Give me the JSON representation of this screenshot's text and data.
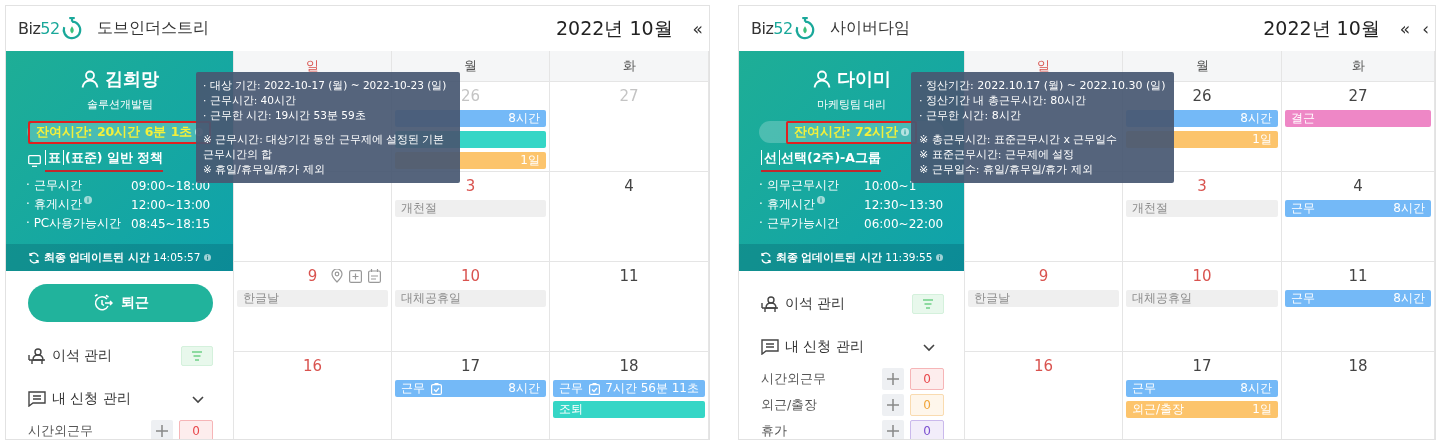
{
  "panels": [
    {
      "logo": {
        "text": "Biz",
        "accent": "52"
      },
      "company": "도브인더스트리",
      "month": "2022년 10월",
      "nav": [
        "«"
      ],
      "user": {
        "name": "김희망",
        "team": "솔루션개발팀"
      },
      "remaining": {
        "text": "잔여시간: 20시간 6분 1초",
        "highlighted": true
      },
      "policy": {
        "tag": "표",
        "name": "(표준) 일반 정책",
        "underlined": true
      },
      "hours": [
        {
          "label": "· 근무시간",
          "value": "09:00~18:00"
        },
        {
          "label": "· 휴게시간",
          "value": "12:00~13:00",
          "info": true
        },
        {
          "label": "· PC사용가능시간",
          "value": "08:45~18:15"
        }
      ],
      "updated": "**최종 업데이트된 시간** 14:05:57",
      "clock_out": "퇴근",
      "away": "이석 관리",
      "requests": {
        "title": "내 신청 관리",
        "expanded": true,
        "items": [
          {
            "label": "시간외근무",
            "count": "0",
            "color": "#e8474b"
          }
        ]
      },
      "weekdays": [
        {
          "label": "일",
          "holiday": true
        },
        {
          "label": "월",
          "holiday": false
        },
        {
          "label": "화",
          "holiday": false
        }
      ],
      "weeks": [
        {
          "monday": {
            "day": "26",
            "other_month": true,
            "events": [
              {
                "kind": "work",
                "value": "8시간"
              },
              {
                "kind": "early_leave"
              },
              {
                "kind": "outside",
                "value": "1일"
              }
            ]
          },
          "tuesday": {
            "day": "27",
            "other_month": true
          }
        },
        {
          "monday": {
            "day": "3",
            "holiday": true,
            "other_month": false,
            "events": [
              {
                "kind": "holiday",
                "label": "개천절"
              }
            ]
          },
          "tuesday": {
            "day": "4",
            "holiday": false,
            "other_month": false
          }
        },
        {
          "sunday": {
            "day": "9",
            "holiday": true,
            "other_month": false,
            "tools": true,
            "events": [
              {
                "kind": "holiday",
                "label": "한글날"
              }
            ]
          },
          "monday": {
            "day": "10",
            "holiday": true,
            "other_month": false,
            "events": [
              {
                "kind": "holiday",
                "label": "대체공휴일"
              }
            ]
          },
          "tuesday": {
            "day": "11",
            "holiday": false,
            "other_month": false
          }
        },
        {
          "sunday": {
            "day": "16",
            "holiday": true,
            "other_month": false
          },
          "monday": {
            "day": "17",
            "holiday": false,
            "other_month": false,
            "events": [
              {
                "kind": "work",
                "label": "근무",
                "approved": true,
                "value": "8시간"
              }
            ]
          },
          "tuesday": {
            "day": "18",
            "holiday": false,
            "other_month": false,
            "events": [
              {
                "kind": "work",
                "label": "근무",
                "approved": true,
                "value": "7시간 56분 11초"
              },
              {
                "kind": "early_leave",
                "label": "조퇴"
              }
            ]
          }
        }
      ],
      "tooltip": {
        "items": [
          "· 대상 기간: 2022-10-17 (월) ~ 2022-10-23 (일)",
          "· 근무시간: 40시간",
          "· 근무한 시간: 19시간 53분 59초"
        ],
        "notes": [
          "※ 근무시간: 대상기간 동안 근무제에 설정된 기본근무시간의 합",
          "※ 휴일/휴무일/휴가 제외"
        ]
      }
    },
    {
      "logo": {
        "text": "Biz",
        "accent": "52"
      },
      "company": "사이버다임",
      "month": "2022년 10월",
      "nav": [
        "«",
        "‹"
      ],
      "user": {
        "name": "다이미",
        "team": "마케팅팀 대리"
      },
      "remaining": {
        "text": "잔여시간: 72시간",
        "highlighted": true
      },
      "policy": {
        "tag": "선",
        "name": "선택(2주)-A그룹",
        "underlined": true
      },
      "hours": [
        {
          "label": "· 의무근무시간",
          "value": "10:00~1"
        },
        {
          "label": "· 휴게시간",
          "value": "12:30~13:30",
          "info": true
        },
        {
          "label": "· 근무가능시간",
          "value": "06:00~22:00"
        }
      ],
      "updated": "**최종 업데이트된 시간** 11:39:55",
      "away": "이석 관리",
      "requests": {
        "title": "내 신청 관리",
        "expanded": true,
        "items": [
          {
            "label": "시간외근무",
            "count": "0",
            "color": "#e8474b"
          },
          {
            "label": "외근/출장",
            "count": "0",
            "color": "#f0a53a"
          },
          {
            "label": "휴가",
            "count": "0",
            "color": "#7b4fd0"
          }
        ]
      },
      "weekdays": [
        {
          "label": "일",
          "holiday": true
        },
        {
          "label": "월",
          "holiday": false
        },
        {
          "label": "화",
          "holiday": false
        }
      ],
      "weeks": [
        {
          "monday": {
            "day": "26",
            "holiday": false,
            "other_month": false,
            "events": [
              {
                "kind": "work",
                "value": "8시간"
              },
              {
                "kind": "outside",
                "value": "1일"
              }
            ]
          },
          "tuesday": {
            "day": "27",
            "holiday": false,
            "other_month": false,
            "events": [
              {
                "kind": "absence",
                "label": "결근"
              }
            ]
          }
        },
        {
          "monday": {
            "day": "3",
            "holiday": true,
            "other_month": false,
            "events": [
              {
                "kind": "holiday",
                "label": "개천절"
              }
            ]
          },
          "tuesday": {
            "day": "4",
            "holiday": false,
            "other_month": false,
            "events": [
              {
                "kind": "work",
                "label": "근무",
                "value": "8시간"
              }
            ]
          }
        },
        {
          "sunday": {
            "day": "9",
            "holiday": true,
            "other_month": false,
            "events": [
              {
                "kind": "holiday",
                "label": "한글날"
              }
            ]
          },
          "monday": {
            "day": "10",
            "holiday": true,
            "other_month": false,
            "events": [
              {
                "kind": "holiday",
                "label": "대체공휴일"
              }
            ]
          },
          "tuesday": {
            "day": "11",
            "holiday": false,
            "other_month": false,
            "events": [
              {
                "kind": "work",
                "label": "근무",
                "value": "8시간"
              }
            ]
          }
        },
        {
          "sunday": {
            "day": "16",
            "holiday": true,
            "other_month": false
          },
          "monday": {
            "day": "17",
            "holiday": false,
            "other_month": false,
            "events": [
              {
                "kind": "work",
                "label": "근무",
                "value": "8시간"
              },
              {
                "kind": "outside",
                "label": "외근/출장",
                "value": "1일"
              }
            ]
          },
          "tuesday": {
            "day": "18",
            "holiday": false,
            "other_month": false
          }
        }
      ],
      "tooltip": {
        "items": [
          "· 정산기간: 2022.10.17 (월) ~ 2022.10.30 (일)",
          "· 정산기간 내 총근무시간: 80시간",
          "· 근무한 시간: 8시간"
        ],
        "notes": [
          "※ 총근무시간: 표준근무시간 x 근무일수",
          "※ 표준근무시간: 근무제에 설정",
          "※ 근무일수: 휴일/휴무일/휴가 제외"
        ]
      }
    }
  ]
}
